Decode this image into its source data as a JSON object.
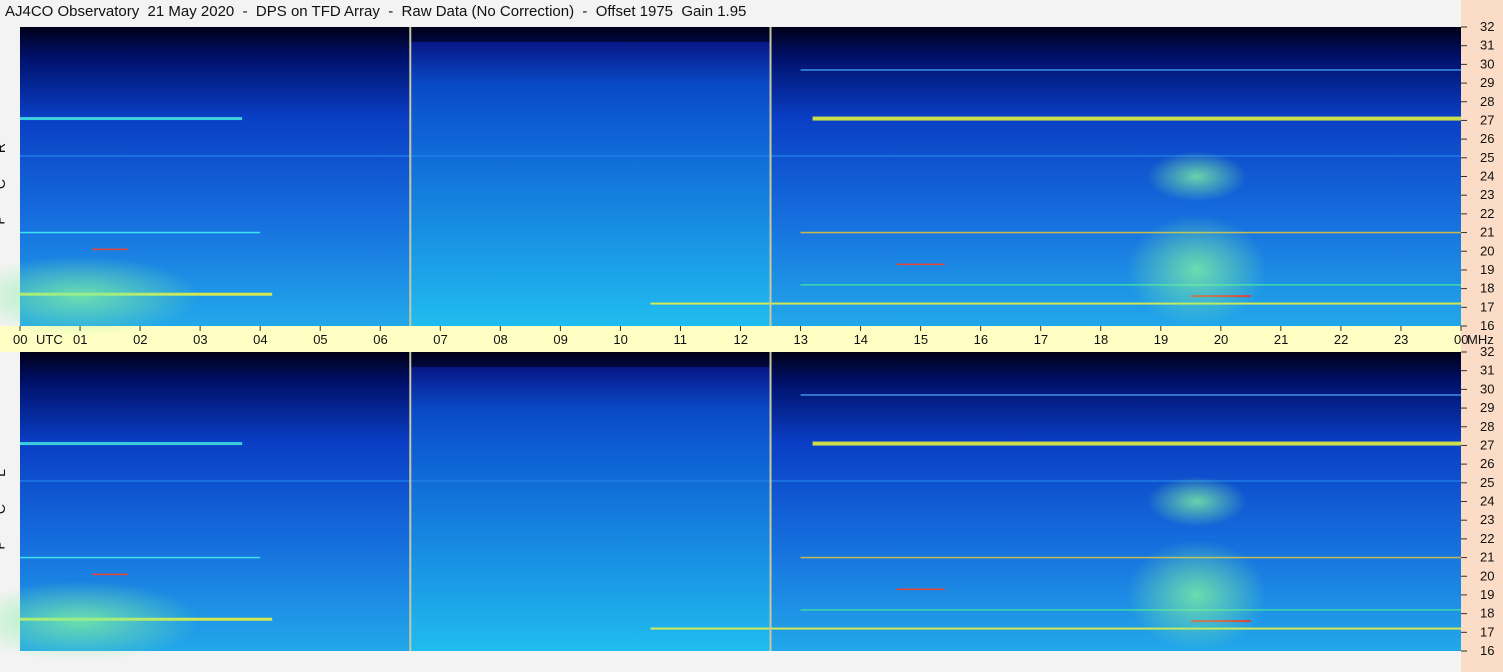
{
  "title": "AJ4CO Observatory  21 May 2020  -  DPS on TFD Array  -  Raw Data (No Correction)  -  Offset 1975  Gain 1.95",
  "chart_data": [
    {
      "type": "heatmap",
      "name": "R C P",
      "xlabel": "UTC",
      "ylabel": "MHz",
      "xlim": [
        "00",
        "00"
      ],
      "ylim": [
        16,
        32
      ],
      "x_tick_labels": [
        "00",
        "01",
        "02",
        "03",
        "04",
        "05",
        "06",
        "07",
        "08",
        "09",
        "10",
        "11",
        "12",
        "13",
        "14",
        "15",
        "16",
        "17",
        "18",
        "19",
        "20",
        "21",
        "22",
        "23",
        "00"
      ],
      "y_tick_labels": [
        "32",
        "31",
        "30",
        "29",
        "28",
        "27",
        "26",
        "25",
        "24",
        "23",
        "22",
        "21",
        "20",
        "19",
        "18",
        "17",
        "16"
      ],
      "colorscale": [
        "#000018",
        "#00147a",
        "#0a3fc8",
        "#1a78e8",
        "#2cc0f0",
        "#40e0a0",
        "#e8f040",
        "#ff4020"
      ]
    },
    {
      "type": "heatmap",
      "name": "L C P",
      "xlabel": "UTC",
      "ylabel": "MHz",
      "xlim": [
        "00",
        "00"
      ],
      "ylim": [
        16,
        32
      ],
      "x_tick_labels": [
        "00",
        "01",
        "02",
        "03",
        "04",
        "05",
        "06",
        "07",
        "08",
        "09",
        "10",
        "11",
        "12",
        "13",
        "14",
        "15",
        "16",
        "17",
        "18",
        "19",
        "20",
        "21",
        "22",
        "23",
        "00"
      ],
      "y_tick_labels": [
        "32",
        "31",
        "30",
        "29",
        "28",
        "27",
        "26",
        "25",
        "24",
        "23",
        "22",
        "21",
        "20",
        "19",
        "18",
        "17",
        "16"
      ],
      "colorscale": [
        "#000018",
        "#00147a",
        "#0a3fc8",
        "#1a78e8",
        "#2cc0f0",
        "#40e0a0",
        "#e8f040",
        "#ff4020"
      ]
    }
  ],
  "labels": {
    "rcp": [
      "R",
      "C",
      "P"
    ],
    "lcp": [
      "L",
      "C",
      "P"
    ],
    "utc": "UTC",
    "mhz": "MHz"
  },
  "colors": {
    "background": "#f3f3f3",
    "time_axis_band": "#ffffc4",
    "freq_axis_strip": "#fbdcc6",
    "marker_line": "#c8c8a0"
  }
}
